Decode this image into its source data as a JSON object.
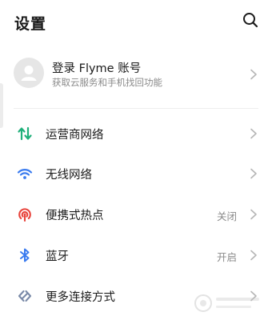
{
  "header": {
    "title": "设置",
    "search_icon": "search-icon"
  },
  "account": {
    "title": "登录 Flyme 账号",
    "subtitle": "获取云服务和手机找回功能",
    "avatar_icon": "person-icon"
  },
  "rows": [
    {
      "label": "运营商网络",
      "value": "",
      "icon": "mobile-data-icon",
      "color": "#1fb07a"
    },
    {
      "label": "无线网络",
      "value": "",
      "icon": "wifi-icon",
      "color": "#3a7bef"
    },
    {
      "label": "便携式热点",
      "value": "关闭",
      "icon": "hotspot-icon",
      "color": "#e8433b"
    },
    {
      "label": "蓝牙",
      "value": "开启",
      "icon": "bluetooth-icon",
      "color": "#3a7bef"
    },
    {
      "label": "更多连接方式",
      "value": "",
      "icon": "link-icon",
      "color": "#7a8aa8"
    }
  ]
}
